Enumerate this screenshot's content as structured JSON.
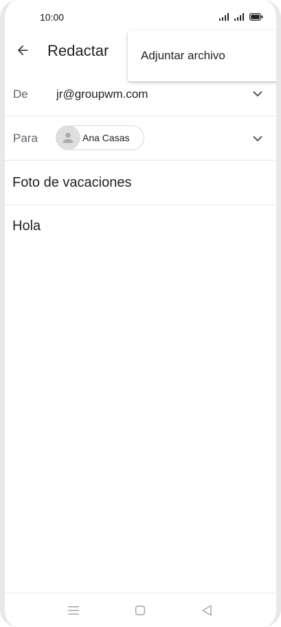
{
  "status_bar": {
    "time": "10:00",
    "icons": [
      "signal-icon",
      "signal-icon",
      "battery-icon"
    ]
  },
  "app_bar": {
    "back_icon": "arrow-back-icon",
    "title": "Redactar"
  },
  "menu": {
    "items": [
      {
        "label": "Adjuntar archivo"
      }
    ]
  },
  "compose": {
    "from": {
      "label": "De",
      "value": "jr@groupwm.com"
    },
    "to": {
      "label": "Para",
      "recipient": "Ana Casas"
    },
    "subject": "Foto de vacaciones",
    "body": "Hola"
  },
  "nav_bar": {
    "icons": [
      "menu-icon",
      "home-icon",
      "back-triangle-icon"
    ]
  },
  "colors": {
    "text": "#202124",
    "label": "#5f6368",
    "divider": "#e6e6e6",
    "avatar_bg": "#dedede"
  }
}
